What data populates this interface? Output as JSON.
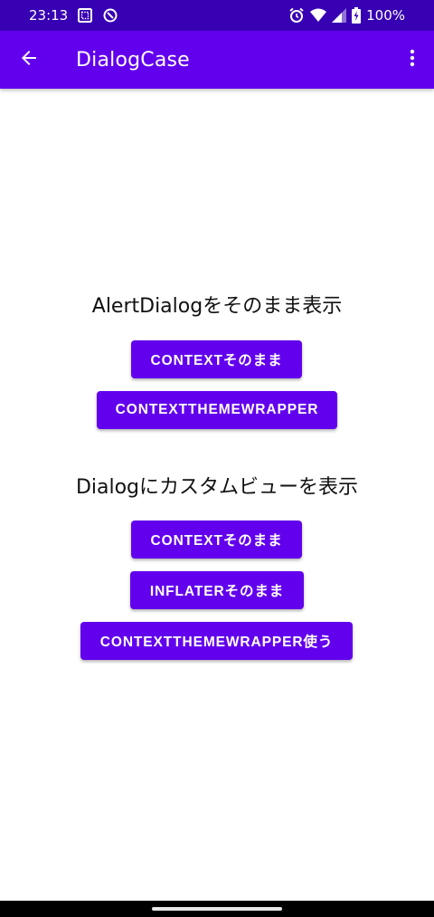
{
  "status_bar": {
    "time": "23:13",
    "battery": "100%",
    "icons": [
      "screenshot-icon",
      "data-saver-icon",
      "alarm-icon",
      "wifi-icon",
      "signal-icon",
      "battery-charging-icon"
    ]
  },
  "app_bar": {
    "title": "DialogCase",
    "back_icon": "arrow-back-icon",
    "overflow_icon": "more-vert-icon"
  },
  "sections": [
    {
      "title": "AlertDialogをそのまま表示",
      "buttons": [
        "CONTEXTそのまま",
        "CONTEXTTHEMEWRAPPER"
      ]
    },
    {
      "title": "Dialogにカスタムビューを表示",
      "buttons": [
        "CONTEXTそのまま",
        "INFLATERそのまま",
        "CONTEXTTHEMEWRAPPER使う"
      ]
    }
  ],
  "colors": {
    "status_bar": "#3700b3",
    "primary": "#6200ee",
    "on_primary": "#ffffff",
    "text": "#111111",
    "background": "#ffffff"
  }
}
